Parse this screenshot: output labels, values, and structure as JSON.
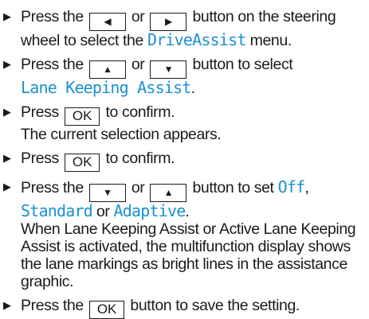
{
  "icons": {
    "bullet": "▶",
    "left": "◀",
    "right": "▶",
    "up": "▲",
    "down": "▼"
  },
  "colors": {
    "menu_text": "#1a8fd1"
  },
  "steps": [
    {
      "t1": "Press the",
      "t2": "or",
      "t3": "button on the steering wheel to select the",
      "menu": "DriveAssist",
      "t4": "menu."
    },
    {
      "t1": "Press the",
      "t2": "or",
      "t3": "button to select",
      "menu": "Lane Keeping Assist",
      "t4": "."
    },
    {
      "t1": "Press",
      "btn": "OK",
      "t2": "to confirm.",
      "t3": "The current selection appears."
    },
    {
      "t1": "Press",
      "btn": "OK",
      "t2": "to confirm."
    },
    {
      "t1": "Press the",
      "t2": "or",
      "t3": "button to set",
      "opt1": "Off",
      "t4": ",",
      "opt2": "Standard",
      "t5": "or",
      "opt3": "Adaptive",
      "t6": ".",
      "note": "When Lane Keeping Assist or Active Lane Keeping Assist is activated, the multifunction display shows the lane markings as bright lines in the assistance graphic."
    },
    {
      "t1": "Press the",
      "btn": "OK",
      "t2": "button to save the setting."
    }
  ]
}
